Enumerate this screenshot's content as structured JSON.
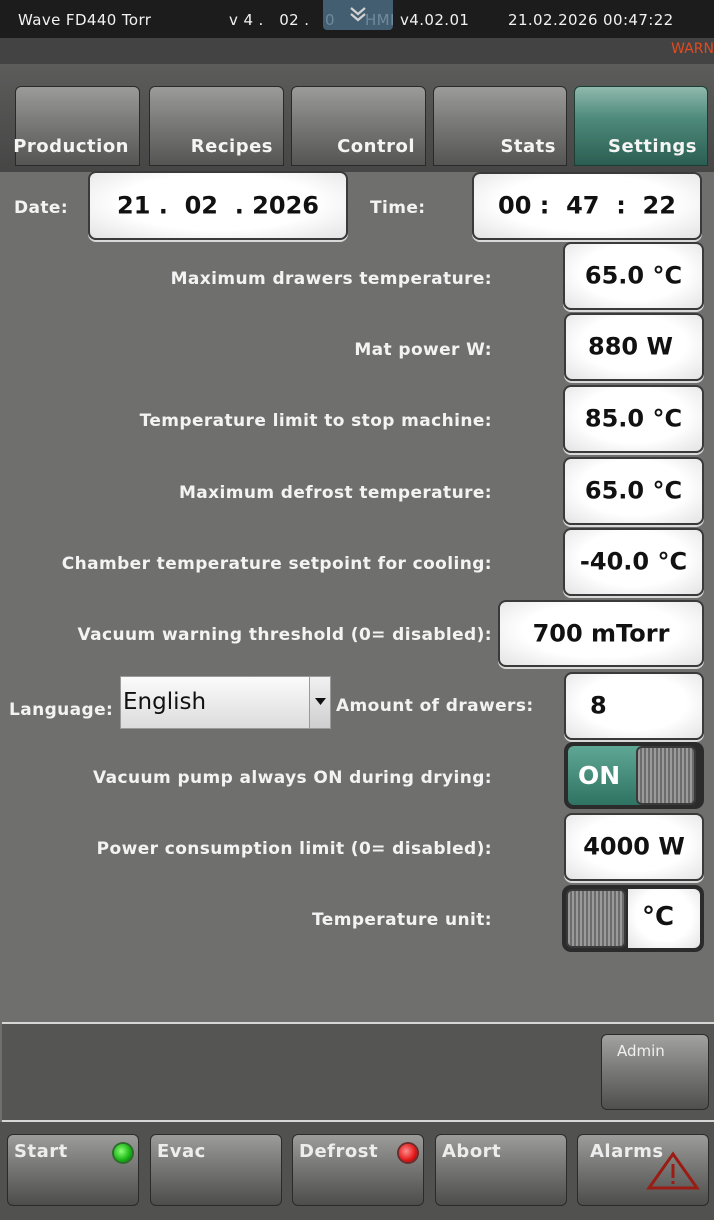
{
  "titlebar": {
    "app_name": "Wave FD440 Torr",
    "version_fragment": "v 4 .   02 .   0",
    "hmi_version": "HMI v4.02.01",
    "datetime": "21.02.2026 00:47:22"
  },
  "alert_text": "WARN",
  "tabs": [
    "Production",
    "Recipes",
    "Control",
    "Stats",
    "Settings"
  ],
  "active_tab": "Settings",
  "date": {
    "label": "Date:",
    "value": "21 .  02  . 2026"
  },
  "time": {
    "label": "Time:",
    "value": "00 :  47  :  22"
  },
  "settings": {
    "max_drawers_temp": {
      "label": "Maximum drawers temperature:",
      "value": "65.0 °C"
    },
    "mat_power": {
      "label": "Mat power W:",
      "value": "880 W"
    },
    "temp_limit_stop": {
      "label": "Temperature limit to stop machine:",
      "value": "85.0 °C"
    },
    "max_defrost_temp": {
      "label": "Maximum defrost temperature:",
      "value": "65.0 °C"
    },
    "chamber_setpoint_cooling": {
      "label": "Chamber temperature setpoint for cooling:",
      "value": "-40.0 °C"
    },
    "vacuum_warning": {
      "label": "Vacuum warning threshold (0= disabled):",
      "value": "700 mTorr"
    },
    "language": {
      "label": "Language:",
      "value": "English"
    },
    "amount_drawers": {
      "label": "Amount of drawers:",
      "value": "8"
    },
    "vacuum_pump_always_on": {
      "label": "Vacuum pump always ON during drying:",
      "value": "ON"
    },
    "power_limit": {
      "label": "Power consumption limit (0= disabled):",
      "value": "4000 W"
    },
    "temp_unit": {
      "label": "Temperature unit:",
      "value": "°C"
    }
  },
  "admin_button": "Admin",
  "bottom_buttons": {
    "start": "Start",
    "evac": "Evac",
    "defrost": "Defrost",
    "abort": "Abort",
    "alarms": "Alarms"
  },
  "colors": {
    "active_tab": "#3f7f70",
    "led_green": "#16b313",
    "led_red": "#e31616",
    "warning": "#e24a1f"
  },
  "icons": [
    "chevron-double-down-icon",
    "dropdown-arrow-icon",
    "green-led-icon",
    "red-led-icon",
    "warning-triangle-icon"
  ]
}
